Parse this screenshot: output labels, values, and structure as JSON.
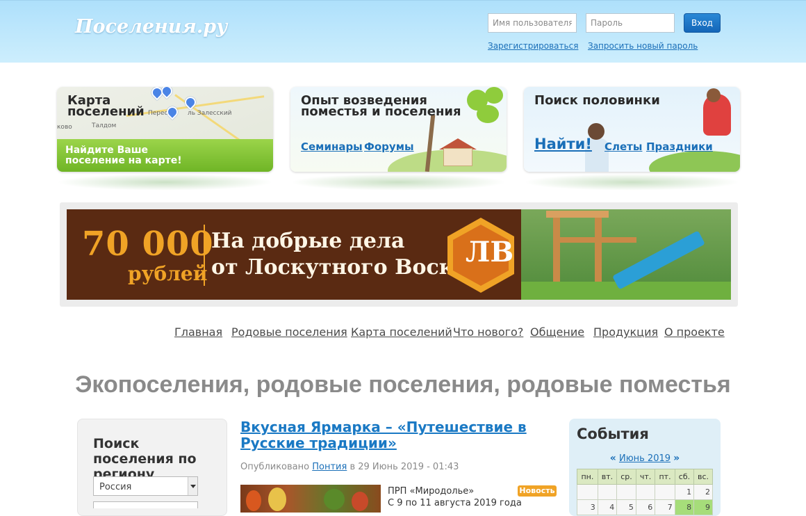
{
  "header": {
    "logo": "Поселения.ру",
    "username_placeholder": "Имя пользователя",
    "password_placeholder": "Пароль",
    "login_button": "Вход",
    "register_link": "Зарегистрироваться",
    "reset_link": "Запросить новый пароль"
  },
  "features": {
    "map": {
      "title": "Карта поселений",
      "map_labels": [
        "Перес",
        "ль Залесский",
        "ково",
        "Талдом"
      ],
      "cta": "Найдите Ваше поселение на карте!"
    },
    "experience": {
      "title": "Опыт возведения поместья и поселения",
      "links": [
        "Семинары",
        "Форумы"
      ]
    },
    "search": {
      "title": "Поиск половинки",
      "find": "Найти!",
      "links": [
        "Слеты",
        "Праздники"
      ]
    }
  },
  "banner": {
    "amount": "70 000",
    "currency": "рублей",
    "line1": "На добрые дела",
    "line2": "от Лоскутного Воска",
    "logo_letters": "ЛВ",
    "colors": {
      "background": "#5a2a12",
      "accent": "#f0a326"
    }
  },
  "nav": [
    "Главная",
    "Родовые поселения",
    "Карта поселений",
    "Что нового?",
    "Общение",
    "Продукция",
    "О проекте"
  ],
  "page_title": "Экопоселения, родовые поселения, родовые поместья",
  "region_search": {
    "title": "Поиск поселения по региону",
    "country_value": "Россия"
  },
  "article": {
    "title": "Вкусная Ярмарка – «Путешествие в Русские традиции»",
    "meta_prefix": "Опубликовано",
    "author": "Понтия",
    "meta_suffix": "в 29 Июнь 2019 - 01:43",
    "organization": "ПРП «Миродолье»",
    "excerpt": "С 9 по 11 августа 2019 года",
    "badge": "Новость"
  },
  "events": {
    "title": "События",
    "prev": "«",
    "month": "Июнь 2019",
    "next": "»",
    "weekdays": [
      "пн.",
      "вт.",
      "ср.",
      "чт.",
      "пт.",
      "сб.",
      "вс."
    ],
    "week1": [
      "",
      "",
      "",
      "",
      "",
      "1",
      "2"
    ],
    "week2": [
      "3",
      "4",
      "5",
      "6",
      "7",
      "8",
      "9"
    ]
  }
}
